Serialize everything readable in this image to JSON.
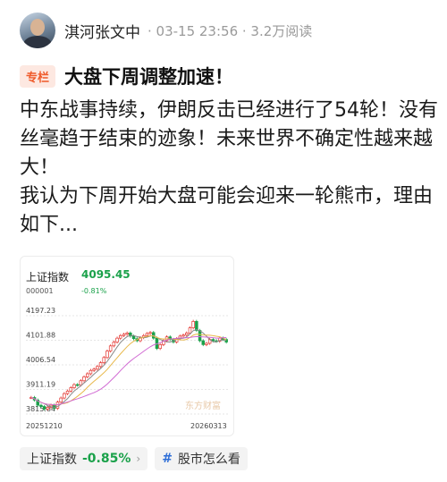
{
  "post": {
    "author": "淇河张文中",
    "meta": "· 03-15 23:56 · 3.2万阅读",
    "tag": "专栏",
    "title": "大盘下周调整加速！",
    "paragraphs": [
      "中东战事持续，伊朗反击已经进行了54轮！没有丝毫趋于结束的迹象！未来世界不确定性越来越大！",
      "我认为下周开始大盘可能会迎来一轮熊市，理由如下..."
    ]
  },
  "card": {
    "index_name": "上证指数",
    "index_value": "4095.45",
    "index_code": "000001",
    "index_change": "-0.81%",
    "watermark": "东方财富",
    "y_labels": [
      "4197.23",
      "4101.88",
      "4006.54",
      "3911.19",
      "3815.84"
    ],
    "date_start": "20251210",
    "date_end": "20260313"
  },
  "chips": {
    "index_label": "上证指数",
    "index_pct": "-0.85%",
    "arrow": "›",
    "hashtag": "#",
    "topic": "股市怎么看"
  },
  "colors": {
    "up": "#e3342f",
    "down": "#1aa14a",
    "ma5": "#888888",
    "ma10": "#e8b84a",
    "ma20": "#d16bd3"
  },
  "chart_data": {
    "type": "candlestick",
    "ylim": [
      3815.84,
      4197.23
    ],
    "x_start": "20251210",
    "x_end": "20260313",
    "values": [
      3880,
      3870,
      3850,
      3845,
      3835,
      3842,
      3850,
      3838,
      3862,
      3878,
      3895,
      3905,
      3918,
      3930,
      3928,
      3945,
      3960,
      3972,
      3985,
      3990,
      4000,
      4015,
      4035,
      4060,
      4080,
      4095,
      4110,
      4120,
      4125,
      4130,
      4118,
      4108,
      4100,
      4112,
      4120,
      4128,
      4132,
      4110,
      4070,
      4085,
      4100,
      4115,
      4105,
      4095,
      4108,
      4118,
      4122,
      4130,
      4150,
      4175,
      4140,
      4100,
      4085,
      4090,
      4105,
      4100,
      4098,
      4110,
      4105,
      4095
    ]
  }
}
